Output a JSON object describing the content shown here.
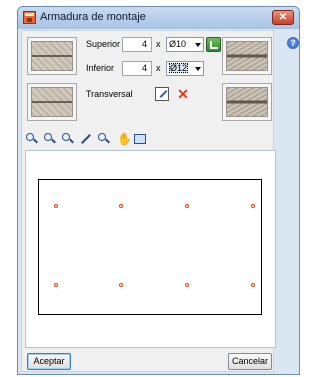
{
  "window": {
    "title": "Armadura de montaje",
    "close_label": "✕"
  },
  "top": {
    "superior": {
      "label": "Superior",
      "count": "4",
      "times": "x",
      "diameter": "Ø10"
    },
    "inferior": {
      "label": "Inferior",
      "count": "4",
      "times": "x",
      "diameter": "Ø12"
    },
    "transversal": {
      "label": "Transversal"
    }
  },
  "toolbar": {
    "tools": [
      "zoom-window-icon",
      "zoom-extents-icon",
      "zoom-previous-icon",
      "measure-icon",
      "zoom-selection-icon",
      "pan-icon",
      "redraw-icon"
    ]
  },
  "canvas": {
    "colors": {
      "section_outline": "#000000",
      "rebar": "#e04010"
    },
    "top_bars": 4,
    "bottom_bars": 4
  },
  "buttons": {
    "accept": "Aceptar",
    "cancel": "Cancelar"
  },
  "help": {
    "label": "?"
  }
}
